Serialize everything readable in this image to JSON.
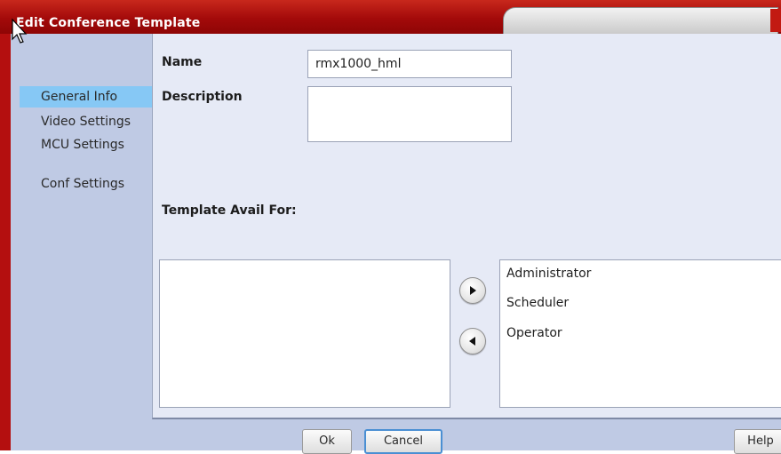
{
  "window": {
    "title": "Edit Conference Template"
  },
  "sidebar": {
    "items": [
      {
        "label": "General Info",
        "active": true
      },
      {
        "label": "Video Settings",
        "active": false
      },
      {
        "label": "MCU Settings",
        "active": false
      },
      {
        "label": "Conf Settings",
        "active": false
      }
    ]
  },
  "form": {
    "name_label": "Name",
    "name_value": "rmx1000_hml",
    "description_label": "Description",
    "description_value": "",
    "avail_label": "Template Avail For:"
  },
  "available_list": {
    "items": []
  },
  "selected_list": {
    "items": [
      "Administrator",
      "Scheduler",
      "Operator"
    ]
  },
  "icons": {
    "move_right": "arrow-right-icon",
    "move_left": "arrow-left-icon",
    "cursor": "mouse-pointer-icon"
  },
  "buttons": {
    "ok": "Ok",
    "cancel": "Cancel",
    "help": "Help"
  },
  "colors": {
    "titlebar": "#a30a0a",
    "sidebar": "#bfcae4",
    "active_nav": "#86c8f5",
    "content_bg": "#e6eaf6",
    "focus_border": "#4a8fd3"
  }
}
